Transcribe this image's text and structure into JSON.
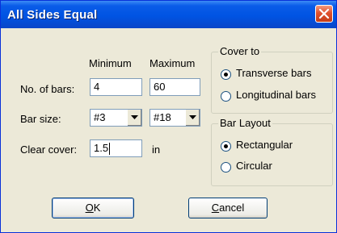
{
  "window": {
    "title": "All Sides Equal",
    "close_icon": "close-icon"
  },
  "columns": {
    "minimum": "Minimum",
    "maximum": "Maximum"
  },
  "bars": {
    "label": "No. of bars:",
    "min_value": "4",
    "max_value": "60"
  },
  "bar_size": {
    "label": "Bar size:",
    "min_selected": "#3",
    "max_selected": "#18"
  },
  "clear_cover": {
    "label": "Clear cover:",
    "value": "1.5",
    "unit": "in"
  },
  "cover_to": {
    "title": "Cover to",
    "options": [
      {
        "label": "Transverse bars",
        "selected": true
      },
      {
        "label": "Longitudinal bars",
        "selected": false
      }
    ]
  },
  "bar_layout": {
    "title": "Bar Layout",
    "options": [
      {
        "label": "Rectangular",
        "selected": true
      },
      {
        "label": "Circular",
        "selected": false
      }
    ]
  },
  "buttons": {
    "ok": {
      "mnemonic": "O",
      "rest": "K"
    },
    "cancel": {
      "mnemonic": "C",
      "rest": "ancel"
    }
  }
}
